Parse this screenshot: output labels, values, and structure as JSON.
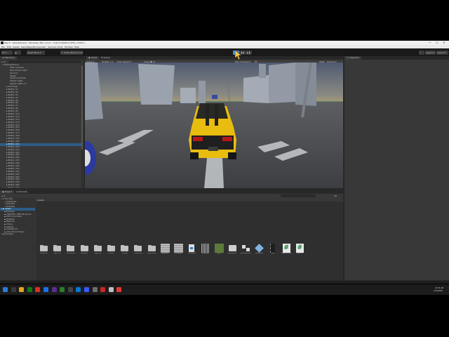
{
  "window": {
    "title": "Day 5 - SampleScene - Windows, Mac, Linux - Unity 6 (6000.0.32f1) <DX11>",
    "controls": [
      "—",
      "☐",
      "✕"
    ]
  },
  "menu": [
    "File",
    "Edit",
    "Assets",
    "GameObject",
    "Component",
    "Services",
    "Tools",
    "Window",
    "Help"
  ],
  "toolbar": {
    "account": "DY ▾",
    "cloud": "☁",
    "asset_store": "Asset Store ▾",
    "unity_version_control": "⛫ Unity Version Control ▾",
    "play": "▶",
    "pause": "❚❚",
    "step": "▶❚",
    "search": "⌕",
    "layers": "Layers ▾",
    "layout": "Layout ▾"
  },
  "hierarchy": {
    "tab": "≡ Hierarchy",
    "add": "+ ▾",
    "search_placeholder": "All",
    "items": [
      {
        "label": "▾ SampleScene",
        "indent": 0
      },
      {
        "label": "Main Camera",
        "indent": 2
      },
      {
        "label": "Directional Light",
        "indent": 2
      },
      {
        "label": "Ground",
        "indent": 2
      },
      {
        "label": "Player",
        "indent": 2
      },
      {
        "label": "Asset Contents",
        "indent": 2
      },
      {
        "label": "Spawn Light",
        "indent": 2
      },
      {
        "label": "Spawn Light (1)",
        "indent": 2
      },
      {
        "label": "▸ buildings",
        "indent": 1
      },
      {
        "label": "▸ Buffer (1)",
        "indent": 1
      },
      {
        "label": "▸ Buffer (2)",
        "indent": 1
      },
      {
        "label": "▸ Buffer (3)",
        "indent": 1
      },
      {
        "label": "▸ Buffer (4)",
        "indent": 1
      },
      {
        "label": "▸ Buffer (5)",
        "indent": 1
      },
      {
        "label": "▸ Buffer (6)",
        "indent": 1
      },
      {
        "label": "▸ Buffer (7)",
        "indent": 1
      },
      {
        "label": "▸ Buffer (8)",
        "indent": 1
      },
      {
        "label": "▸ Buffer (9)",
        "indent": 1
      },
      {
        "label": "▸ Buffer (10)",
        "indent": 1
      },
      {
        "label": "▸ Buffer (11)",
        "indent": 1
      },
      {
        "label": "▸ Buffer (12)",
        "indent": 1
      },
      {
        "label": "▸ Buffer (13)",
        "indent": 1
      },
      {
        "label": "▸ Buffer (14)",
        "indent": 1
      },
      {
        "label": "▸ Buffer (15)",
        "indent": 1
      },
      {
        "label": "▸ Buffer (16)",
        "indent": 1
      },
      {
        "label": "▸ Buffer (17)",
        "indent": 1
      },
      {
        "label": "▸ Buffer (18)",
        "indent": 1
      },
      {
        "label": "▸ Buffer (19)",
        "indent": 1
      },
      {
        "label": "▸ Buffer (20)",
        "indent": 1
      },
      {
        "label": "▸ Buffer (21)",
        "indent": 1
      },
      {
        "label": "▸ Buffer (22)",
        "indent": 1
      },
      {
        "label": "▸ Buffer (23)",
        "indent": 1
      },
      {
        "label": "▸ Buffer (24)",
        "indent": 1
      },
      {
        "label": "▸ Buffer (25)",
        "indent": 1
      },
      {
        "label": "▸ Buffer (26)",
        "indent": 1
      },
      {
        "label": "▸ Buffer (27)",
        "indent": 1
      },
      {
        "label": "▸ Buffer (28)",
        "indent": 1
      },
      {
        "label": "▸ Buffer (29)",
        "indent": 1
      },
      {
        "label": "▸ Buffer (30)",
        "indent": 1
      },
      {
        "label": "▸ Buffer (31)",
        "indent": 1
      },
      {
        "label": "▸ Buffer (32)",
        "indent": 1
      },
      {
        "label": "▸ Buffer (33)",
        "indent": 1
      },
      {
        "label": "▸ Buffer (34)",
        "indent": 1
      },
      {
        "label": "▸ Buffer (35)",
        "indent": 1
      },
      {
        "label": "▸ Buffer (36)",
        "indent": 1
      },
      {
        "label": "▸ Buffer (37)",
        "indent": 1
      },
      {
        "label": "▸ Buffer (38)",
        "indent": 1
      },
      {
        "label": "▸ Buffer (39)",
        "indent": 1
      },
      {
        "label": "▸ Cube (1)",
        "indent": 1
      },
      {
        "label": "▸ Cube (2)",
        "indent": 1
      },
      {
        "label": "▸ Cube (3)",
        "indent": 1
      },
      {
        "label": "▸ Cube (4)",
        "indent": 1
      },
      {
        "label": "▸ Cube (5)",
        "indent": 1
      },
      {
        "label": "▸ Cube (6)",
        "indent": 1
      }
    ],
    "selected_index": 29
  },
  "view_tabs": {
    "game": "◉ Game",
    "scene": "# Scene"
  },
  "game_toolbar": {
    "display": "Game ▾",
    "display_num": "Display 1 ▾",
    "aspect": "Free Aspect ▾",
    "scale": "Scale ● 1x",
    "play_focused": "Play Focused ▾",
    "mute": "🔇",
    "stats": "Stats",
    "gizmos": "Gizmos ▾"
  },
  "inspector": {
    "tab": "ⓘ Inspector"
  },
  "project": {
    "tabs": [
      "▣ Project",
      "≡ Console"
    ],
    "add": "+ ▾",
    "count": "24",
    "breadcrumb": "Assets",
    "tree": [
      {
        "label": "▾ ★ Favorites",
        "indent": 0
      },
      {
        "label": "⌕ All Materials",
        "indent": 1
      },
      {
        "label": "⌕ All Models",
        "indent": 1
      },
      {
        "label": "⌕ All Prefabs",
        "indent": 1
      },
      {
        "label": "▾ ▬ Assets",
        "indent": 0,
        "selected": true
      },
      {
        "label": "▬ Buildings",
        "indent": 1
      },
      {
        "label": "▬ CARTOON - FREE Racing Car",
        "indent": 1
      },
      {
        "label": "▬ FPS Fly Controller",
        "indent": 1
      },
      {
        "label": "▬ Materials",
        "indent": 1
      },
      {
        "label": "▬ Night Sky",
        "indent": 1
      },
      {
        "label": "▬ Scenes",
        "indent": 1
      },
      {
        "label": "▬ Settings",
        "indent": 1
      },
      {
        "label": "▬ TextMesh Pro",
        "indent": 1
      },
      {
        "label": "▬ Unity Terrain Plugins",
        "indent": 1
      },
      {
        "label": "▸ ▬ Packages",
        "indent": 0
      }
    ],
    "assets": [
      {
        "label": "Animation",
        "kind": "folder"
      },
      {
        "label": "CARTOON",
        "kind": "folder"
      },
      {
        "label": "Environment",
        "kind": "folder"
      },
      {
        "label": "Materials",
        "kind": "folder"
      },
      {
        "label": "Night Sky",
        "kind": "folder"
      },
      {
        "label": "Scenes",
        "kind": "folder"
      },
      {
        "label": "Settings",
        "kind": "folder"
      },
      {
        "label": "TextMeshPro",
        "kind": "folder"
      },
      {
        "label": "Unity Terrain",
        "kind": "folder"
      },
      {
        "label": "buildings2",
        "kind": "texture-light"
      },
      {
        "label": "buildings3",
        "kind": "texture-light"
      },
      {
        "label": "Buildings4",
        "kind": "doc"
      },
      {
        "label": "buildings5",
        "kind": "texture-dark"
      },
      {
        "label": "Grass",
        "kind": "grass"
      },
      {
        "label": "InputSystem",
        "kind": "input"
      },
      {
        "label": "New Input Actions",
        "kind": "graph"
      },
      {
        "label": "Roadmaker",
        "kind": "cube"
      },
      {
        "label": "road",
        "kind": "road"
      },
      {
        "label": "RoadGenerator",
        "kind": "script"
      },
      {
        "label": "TrafficCtrl",
        "kind": "script"
      }
    ]
  },
  "taskbar": {
    "time": "12:33 AM",
    "date": "1/15/2025",
    "colors": [
      "#2b7cd3",
      "#3a3a3a",
      "#e3a21a",
      "#0f7b0f",
      "#d93025",
      "#1a73e8",
      "#5c2d91",
      "#2d7d32",
      "#444444",
      "#0078d4",
      "#3d5afe",
      "#6e6e6e",
      "#c62828",
      "#c0c0c0",
      "#e53935"
    ]
  },
  "scene_colors": {
    "sky_top": "#4f5a70",
    "sky_bottom": "#b8a06a",
    "ground": "#5f8a66",
    "road": "#46484c",
    "car": "#e9bd10"
  }
}
